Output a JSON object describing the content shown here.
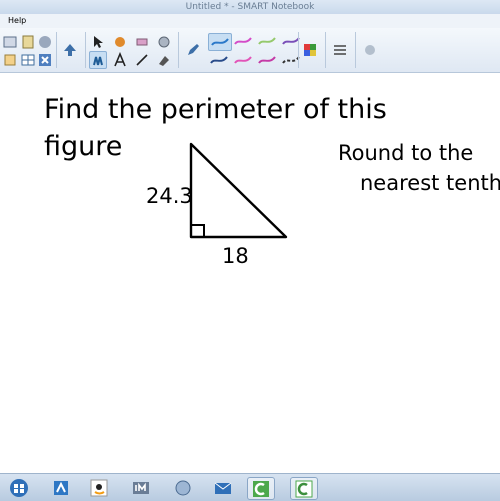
{
  "window": {
    "title": "Untitled * - SMART Notebook"
  },
  "menu": {
    "help_label": "Help"
  },
  "toolbar": {
    "icons": [
      "paste-icon",
      "screen-shade-icon",
      "capture-icon",
      "select-icon",
      "magic-pen-icon",
      "eraser-icon",
      "pen-icon",
      "table-icon",
      "shapes-icon",
      "line-icon",
      "fill-icon"
    ]
  },
  "page": {
    "prompt_line1": "Find the perimeter of this",
    "prompt_line2": "figure",
    "note_line1": "Round to the",
    "note_line2": "nearest tenth",
    "side_vertical": "24.3",
    "side_horizontal": "18"
  },
  "taskbar": {
    "apps": [
      "windows-start-icon",
      "notebook-icon",
      "amazon-icon",
      "im-icon",
      "browser-icon",
      "mail-icon",
      "camtasia-icon",
      "smart-icon"
    ]
  },
  "colors": {
    "pen_selected": "#2b79c9",
    "taskbar_bg": "#c6d6e8"
  }
}
